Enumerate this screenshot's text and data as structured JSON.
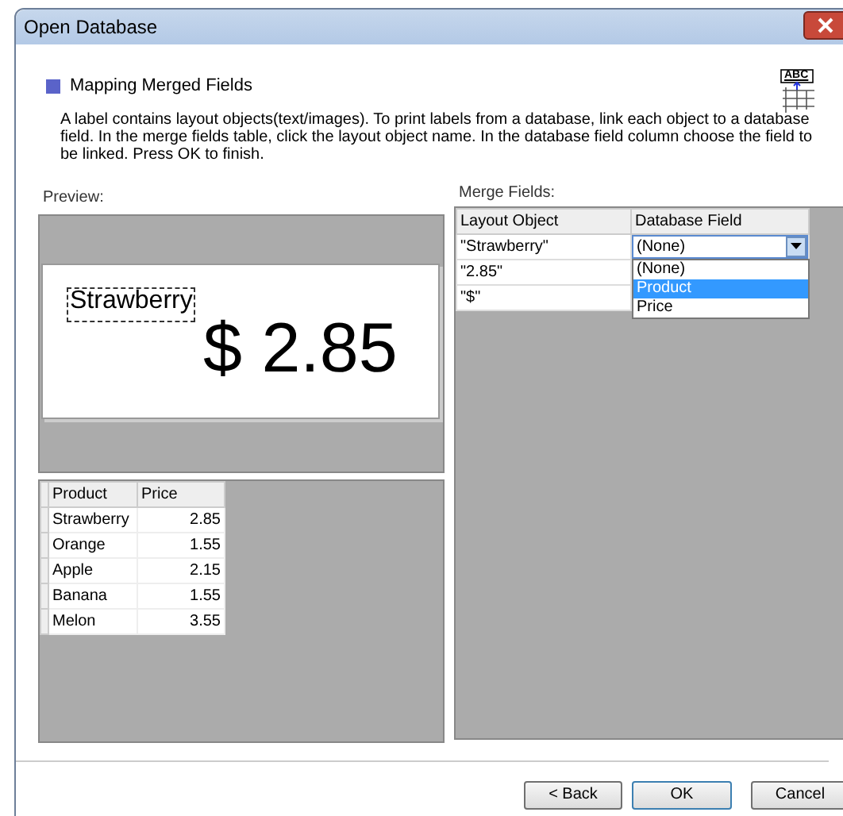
{
  "window": {
    "title": "Open Database"
  },
  "header": {
    "title": "Mapping Merged Fields",
    "icon_label": "ABC",
    "description": "A label contains layout objects(text/images). To print labels from a database, link each object to a database field. In the merge fields table, click the layout object name. In the database field column choose the field to be linked. Press OK to finish."
  },
  "preview": {
    "label": "Preview:",
    "objects": [
      {
        "text": "Strawberry",
        "selected": true
      },
      {
        "text": "$ 2.85",
        "selected": false
      }
    ]
  },
  "data_table": {
    "columns": [
      "Product",
      "Price"
    ],
    "rows": [
      [
        "Strawberry",
        "2.85"
      ],
      [
        "Orange",
        "1.55"
      ],
      [
        "Apple",
        "2.15"
      ],
      [
        "Banana",
        "1.55"
      ],
      [
        "Melon",
        "3.55"
      ]
    ]
  },
  "merge_fields": {
    "label": "Merge Fields:",
    "columns": [
      "Layout Object",
      "Database Field"
    ],
    "rows": [
      {
        "layout_object": "\"Strawberry\"",
        "database_field": "(None)"
      },
      {
        "layout_object": "\"2.85\""
      },
      {
        "layout_object": "\"$\""
      }
    ],
    "dropdown": {
      "expanded": true,
      "options": [
        {
          "label": "(None)",
          "selected": false
        },
        {
          "label": "Product",
          "selected": true
        },
        {
          "label": "Price",
          "selected": false
        }
      ]
    }
  },
  "buttons": [
    "< Back",
    "OK",
    "Cancel"
  ]
}
